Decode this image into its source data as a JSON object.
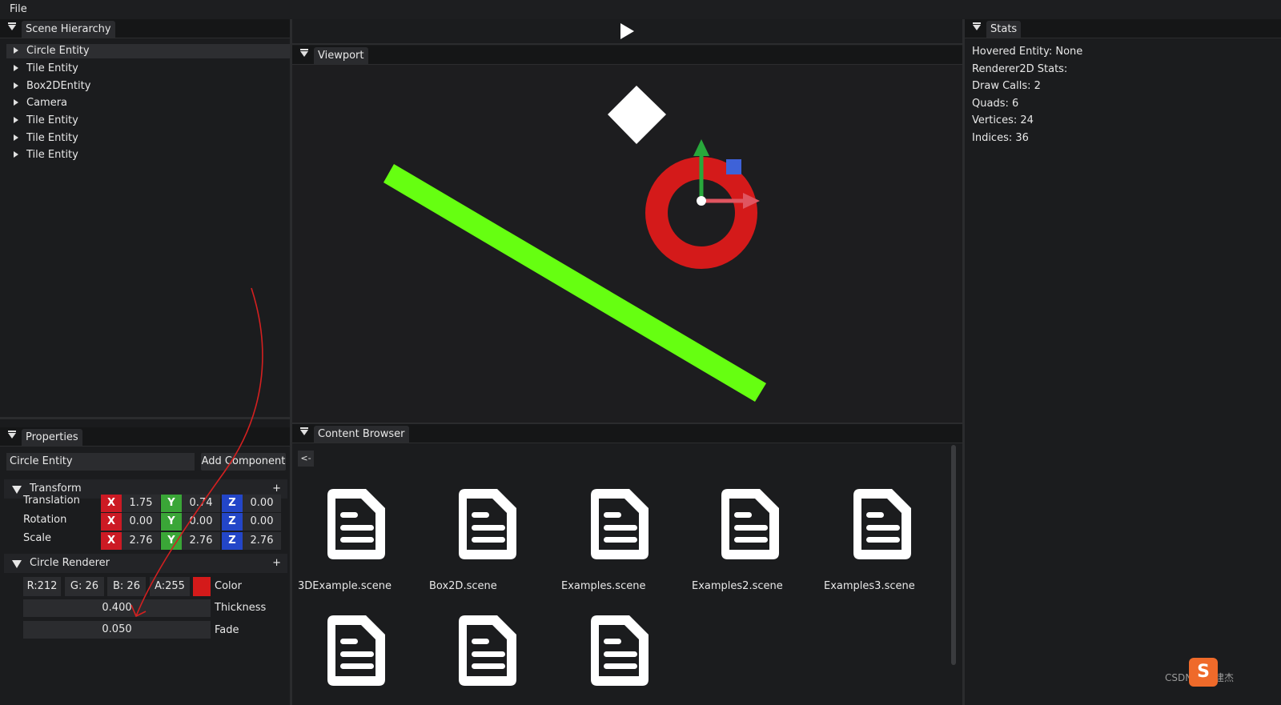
{
  "menu": {
    "file_label": "File"
  },
  "scene_hierarchy": {
    "tab_label": "Scene Hierarchy",
    "items": [
      {
        "label": "Circle Entity",
        "selected": true
      },
      {
        "label": "Tile Entity"
      },
      {
        "label": "Box2DEntity"
      },
      {
        "label": "Camera"
      },
      {
        "label": "Tile Entity"
      },
      {
        "label": "Tile Entity"
      },
      {
        "label": "Tile Entity"
      }
    ]
  },
  "properties": {
    "tab_label": "Properties",
    "entity_name": "Circle Entity",
    "add_component_label": "Add Component",
    "transform": {
      "header": "Transform",
      "plus": "+",
      "axis_labels": {
        "x": "X",
        "y": "Y",
        "z": "Z"
      },
      "translation": {
        "label": "Translation",
        "x": "1.75",
        "y": "0.74",
        "z": "0.00"
      },
      "rotation": {
        "label": "Rotation",
        "x": "0.00",
        "y": "0.00",
        "z": "0.00"
      },
      "scale": {
        "label": "Scale",
        "x": "2.76",
        "y": "2.76",
        "z": "2.76"
      }
    },
    "circle_renderer": {
      "header": "Circle Renderer",
      "plus": "+",
      "r": "R:212",
      "g": "G: 26",
      "b": "B: 26",
      "a": "A:255",
      "color_label": "Color",
      "color_value": "#d41a1a",
      "thickness": {
        "label": "Thickness",
        "value": "0.400"
      },
      "fade": {
        "label": "Fade",
        "value": "0.050"
      }
    }
  },
  "viewport": {
    "tab_label": "Viewport",
    "play_icon": "play-icon",
    "colors": {
      "background": "#1d1d1f",
      "circle": "#d41a1a",
      "bar": "#66ff11",
      "diamond": "#ffffff",
      "gizmo_x": "#e05560",
      "gizmo_y": "#28a83b",
      "gizmo_plane": "#3e62d8"
    }
  },
  "content_browser": {
    "tab_label": "Content Browser",
    "back_label": "<-",
    "files": [
      {
        "name": "3DExample.scene"
      },
      {
        "name": "Box2D.scene"
      },
      {
        "name": "Examples.scene"
      },
      {
        "name": "Examples2.scene"
      },
      {
        "name": "Examples3.scene"
      },
      {
        "name": ""
      },
      {
        "name": ""
      },
      {
        "name": ""
      }
    ]
  },
  "stats": {
    "tab_label": "Stats",
    "lines": [
      "Hovered Entity: None",
      "Renderer2D Stats:",
      "Draw Calls: 2",
      "Quads: 6",
      "Vertices: 24",
      "Indices: 36"
    ]
  },
  "watermark": {
    "text": "CSDN @刘建杰",
    "icon_letter": "S"
  }
}
